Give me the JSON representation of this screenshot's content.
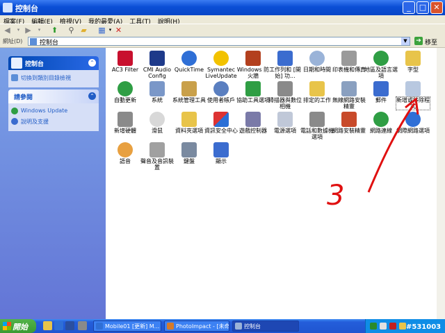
{
  "window": {
    "title": "控制台"
  },
  "menu": [
    "檔案(F)",
    "編輯(E)",
    "檢視(V)",
    "我的最愛(A)",
    "工具(T)",
    "說明(H)"
  ],
  "address": {
    "label": "網址(D)",
    "value": "控制台",
    "go_label": "移至"
  },
  "left_pane": {
    "panel1": {
      "title": "控制台",
      "link": "切換到類別目錄檢視"
    },
    "panel2": {
      "title": "請參閱",
      "links": [
        "Windows Update",
        "說明及支援"
      ]
    }
  },
  "icons": [
    {
      "label": "AC3 Filter"
    },
    {
      "label": "CMI Audio Config"
    },
    {
      "label": "QuickTime"
    },
    {
      "label": "Symantec LiveUpdate"
    },
    {
      "label": "Windows 防火牆"
    },
    {
      "label": "工作列和 [開始] 功..."
    },
    {
      "label": "日期和時間"
    },
    {
      "label": "印表機和傳真"
    },
    {
      "label": "地區及語言選項"
    },
    {
      "label": "字型"
    },
    {
      "label": "自動更新"
    },
    {
      "label": "系統"
    },
    {
      "label": "系統管理工具"
    },
    {
      "label": "使用者帳戶"
    },
    {
      "label": "協助工具選項"
    },
    {
      "label": "掃描器與數位相機"
    },
    {
      "label": "排定的工作"
    },
    {
      "label": "無線網路安裝精靈"
    },
    {
      "label": "郵件"
    },
    {
      "label": "新增或移除程式"
    },
    {
      "label": "新增硬體"
    },
    {
      "label": "滑鼠"
    },
    {
      "label": "資料夾選項"
    },
    {
      "label": "資訊安全中心"
    },
    {
      "label": "遊戲控制器"
    },
    {
      "label": "電源選項"
    },
    {
      "label": "電話和數據機選項"
    },
    {
      "label": "網路安裝精靈"
    },
    {
      "label": "網路連線"
    },
    {
      "label": "網際網路選項"
    },
    {
      "label": "語音"
    },
    {
      "label": "聲音及音訊裝置"
    },
    {
      "label": "鍵盤"
    },
    {
      "label": "顯示"
    }
  ],
  "annotation": {
    "text": "3"
  },
  "taskbar": {
    "start": "開始",
    "tasks": [
      "Mobile01 [更新] M...",
      "PhotoImpact - [未命...",
      "控制台"
    ]
  },
  "watermark": "#531003"
}
